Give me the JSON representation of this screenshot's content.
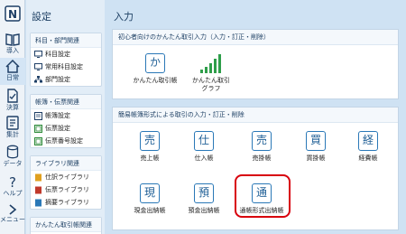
{
  "rail": {
    "items": [
      {
        "label": ""
      },
      {
        "label": "導入"
      },
      {
        "label": "日常"
      },
      {
        "label": "決算"
      },
      {
        "label": "集計"
      },
      {
        "label": "データ"
      },
      {
        "label": "ヘルプ"
      },
      {
        "label": "メニュー"
      }
    ]
  },
  "settings": {
    "title": "設定",
    "groups": [
      {
        "header": "科目・部門関連",
        "items": [
          "科目設定",
          "常用科目設定",
          "部門設定"
        ]
      },
      {
        "header": "帳簿・伝票関連",
        "items": [
          "帳簿設定",
          "伝票設定",
          "伝票番号設定"
        ]
      },
      {
        "header": "ライブラリ関連",
        "items": [
          "仕訳ライブラリ",
          "伝票ライブラリ",
          "摘要ライブラリ"
        ]
      },
      {
        "header": "かんたん取引帳関連",
        "items": []
      }
    ]
  },
  "main": {
    "title": "入力",
    "panel1": {
      "header": "初心者向けのかんたん取引入力（入力・訂正・削除）",
      "tiles": [
        {
          "glyph": "か",
          "label": "かんたん取引帳"
        },
        {
          "label": "かんたん取引\nグラフ"
        }
      ]
    },
    "panel2": {
      "header": "簡易帳簿形式による取引の入力・訂正・削除",
      "tiles": [
        {
          "glyph": "売",
          "label": "売上帳"
        },
        {
          "glyph": "仕",
          "label": "仕入帳"
        },
        {
          "glyph": "売",
          "label": "売掛帳"
        },
        {
          "glyph": "買",
          "label": "買掛帳"
        },
        {
          "glyph": "経",
          "label": "経費帳"
        },
        {
          "glyph": "現",
          "label": "現金出納帳"
        },
        {
          "glyph": "預",
          "label": "預金出納帳"
        },
        {
          "glyph": "通",
          "label": "通帳形式出納帳"
        }
      ]
    }
  },
  "colors": {
    "accent": "#2a78b7",
    "highlight": "#d8000c"
  }
}
